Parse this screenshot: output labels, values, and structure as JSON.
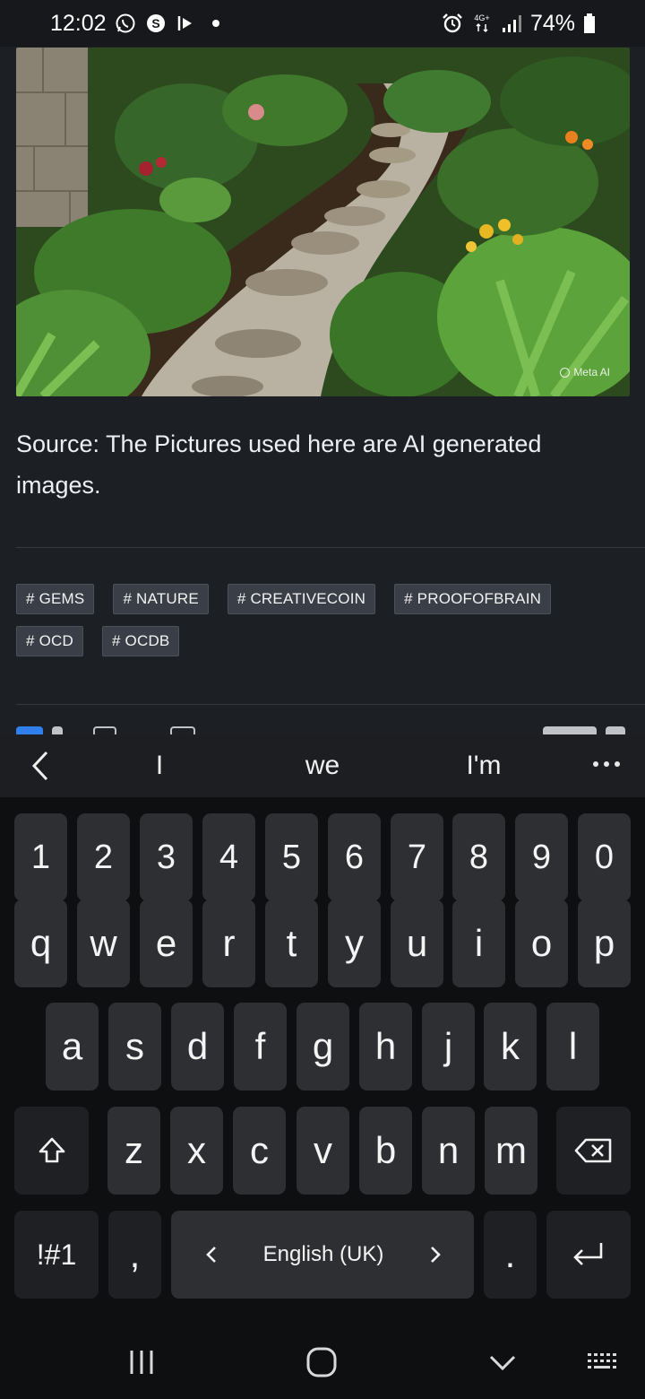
{
  "status_bar": {
    "time": "12:02",
    "left_icons": [
      "whatsapp-icon",
      "skype-icon",
      "bixby-icon"
    ],
    "network": "4G+",
    "battery": "74%"
  },
  "post": {
    "image_watermark": "Meta AI",
    "source_text": "Source: The Pictures used here are AI generated images.",
    "tags": [
      "# GEMS",
      "# NATURE",
      "# CREATIVECOIN",
      "# PROOFOFBRAIN",
      "# OCD",
      "# OCDB"
    ]
  },
  "keyboard": {
    "suggestions": [
      "I",
      "we",
      "I'm"
    ],
    "number_row": [
      "1",
      "2",
      "3",
      "4",
      "5",
      "6",
      "7",
      "8",
      "9",
      "0"
    ],
    "row1": [
      "q",
      "w",
      "e",
      "r",
      "t",
      "y",
      "u",
      "i",
      "o",
      "p"
    ],
    "row2": [
      "a",
      "s",
      "d",
      "f",
      "g",
      "h",
      "j",
      "k",
      "l"
    ],
    "row3": [
      "z",
      "x",
      "c",
      "v",
      "b",
      "n",
      "m"
    ],
    "symbols_label": "!#1",
    "comma": ",",
    "language": "English (UK)",
    "period": "."
  },
  "colors": {
    "background": "#1c1f24",
    "keyboard_bg": "#0e0f11",
    "key_bg": "#2e2f33",
    "tag_bg": "#3a3f47"
  }
}
